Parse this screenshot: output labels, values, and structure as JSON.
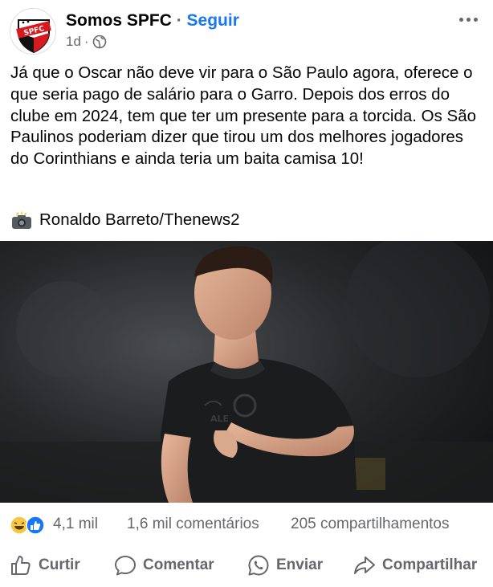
{
  "post": {
    "page_name": "Somos SPFC",
    "separator": "·",
    "follow_label": "Seguir",
    "time": "1d",
    "time_dot": "·",
    "text": "Já que o Oscar não deve vir para o São Paulo agora, oferece o que seria pago de salário para o Garro. Depois dos erros do clube em 2024, tem que ter um presente para a torcida. Os São Paulinos poderiam dizer que tirou um dos melhores jogadores do Corinthians e ainda teria um baita camisa 10!",
    "photo_credit": "Ronaldo Barreto/Thenews2"
  },
  "avatar_logo_text": "SPFC",
  "photo_shirt_text": "ALE",
  "stats": {
    "reactions_count": "4,1 mil",
    "comments": "1,6 mil comentários",
    "shares": "205 compartilhamentos"
  },
  "actions": {
    "like": "Curtir",
    "comment": "Comentar",
    "send": "Enviar",
    "share": "Compartilhar"
  },
  "colors": {
    "link": "#1877f2",
    "secondary_text": "#65676b",
    "spfc_red": "#d71920"
  }
}
